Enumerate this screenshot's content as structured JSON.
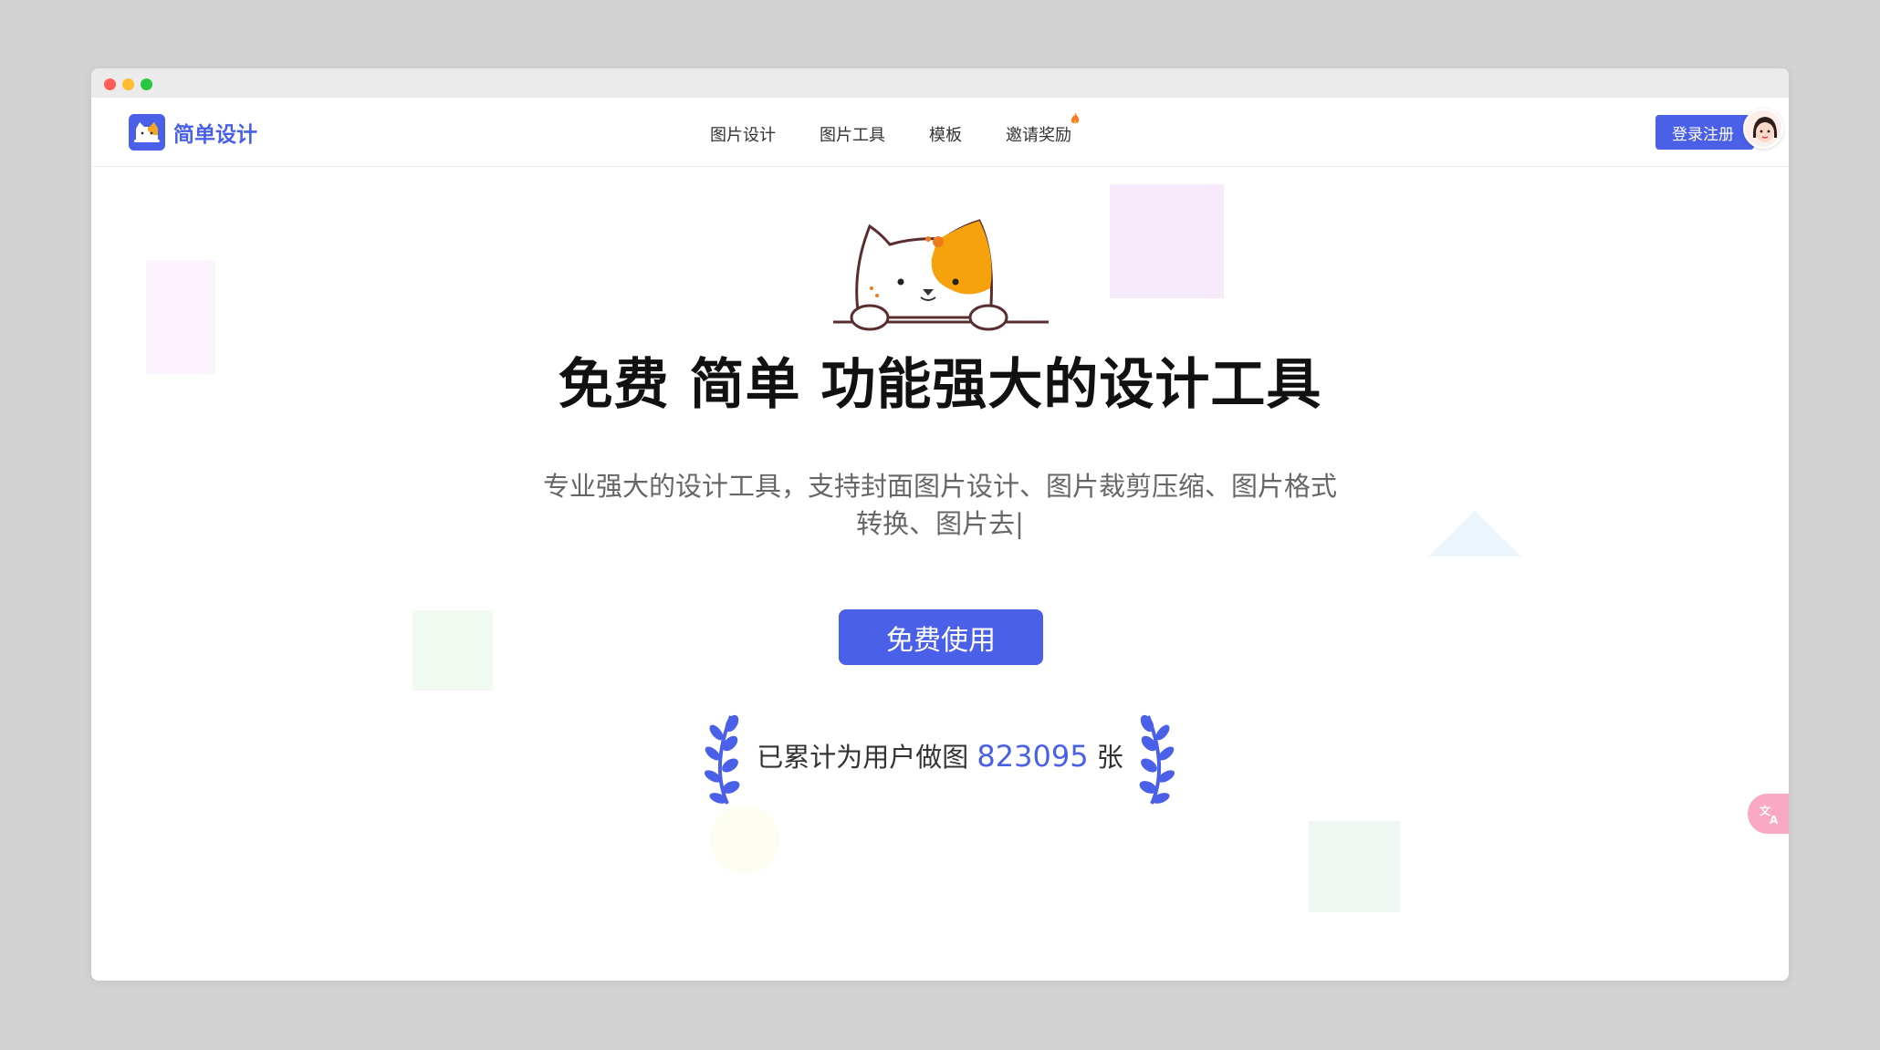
{
  "window": {
    "controls": [
      "close",
      "minimize",
      "maximize"
    ]
  },
  "brand": {
    "name": "简单设计",
    "logo_icon": "cat-logo-icon",
    "color": "#4a60e8"
  },
  "nav": {
    "items": [
      {
        "label": "图片设计"
      },
      {
        "label": "图片工具"
      },
      {
        "label": "模板"
      },
      {
        "label": "邀请奖励",
        "badge_icon": "flame-icon"
      }
    ]
  },
  "header": {
    "login_label": "登录注册",
    "avatar_icon": "user-avatar-icon"
  },
  "hero": {
    "mascot_icon": "cat-mascot-icon",
    "title": "免费 简单 功能强大的设计工具",
    "subtitle": "专业强大的设计工具，支持封面图片设计、图片裁剪压缩、图片格式转换、图片去|",
    "cta_label": "免费使用",
    "counter_prefix": "已累计为用户做图",
    "counter_value": "823095",
    "counter_suffix": "张"
  },
  "floating": {
    "translate_icon": "translate-icon"
  },
  "colors": {
    "accent": "#4a60e8",
    "translate_bg": "#f9a9c3"
  }
}
